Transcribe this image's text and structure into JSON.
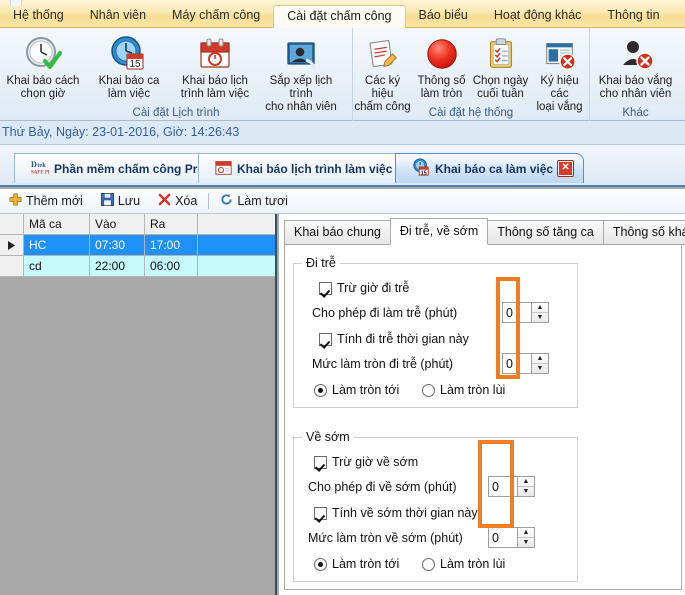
{
  "menubar": {
    "items": [
      {
        "label": "Hệ thống",
        "active": false
      },
      {
        "label": "Nhân viên",
        "active": false
      },
      {
        "label": "Máy chấm công",
        "active": false
      },
      {
        "label": "Cài đặt chấm công",
        "active": true
      },
      {
        "label": "Báo biểu",
        "active": false
      },
      {
        "label": "Hoạt động khác",
        "active": false
      },
      {
        "label": "Thông tin",
        "active": false
      }
    ]
  },
  "ribbon": {
    "groups": [
      {
        "label": "Cài đặt Lịch trình",
        "buttons": [
          {
            "caption": "Khai báo cách\nchọn giờ",
            "icon": "clock-check-icon"
          },
          {
            "caption": "Khai báo ca\nlàm việc",
            "icon": "clock-calendar-icon"
          },
          {
            "caption": "Khai báo lịch\ntrình làm việc",
            "icon": "calendar-clock-icon"
          },
          {
            "caption": "Sắp xếp lịch trình\ncho nhân viên",
            "icon": "person-photo-icon"
          }
        ]
      },
      {
        "label": "Cài đặt hệ thống",
        "buttons": [
          {
            "caption": "Các ký hiệu\nchấm công",
            "icon": "note-pencil-icon"
          },
          {
            "caption": "Thông số\nlàm tròn",
            "icon": "red-circle-icon"
          },
          {
            "caption": "Chọn ngày\ncuối tuần",
            "icon": "clipboard-check-icon"
          },
          {
            "caption": "Ký hiệu các\nloại vắng",
            "icon": "window-delete-icon"
          }
        ]
      },
      {
        "label": "Khác",
        "buttons": [
          {
            "caption": "Khai báo vắng\ncho nhân viên",
            "icon": "person-delete-icon"
          }
        ]
      }
    ]
  },
  "datebar": {
    "text": "Thứ Bảy, Ngày: 23-01-2016, Giờ: 14:26:43"
  },
  "doctabs": [
    {
      "label": "Phần mềm chấm công Pro",
      "icon": "app-logo-icon",
      "selected": false,
      "closable": false
    },
    {
      "label": "Khai báo lịch trình làm việc",
      "icon": "calendar-icon",
      "selected": false,
      "closable": true,
      "close_label": "✕"
    },
    {
      "label": "Khai báo ca làm việc",
      "icon": "clock-calendar-icon",
      "selected": true,
      "closable": true,
      "close_label": "✕"
    }
  ],
  "actionbar": {
    "buttons": [
      {
        "label": "Thêm mới",
        "icon": "plus-icon"
      },
      {
        "label": "Lưu",
        "icon": "save-icon"
      },
      {
        "label": "Xóa",
        "icon": "delete-x-icon"
      },
      {
        "label": "Làm tươi",
        "icon": "refresh-icon"
      }
    ]
  },
  "grid": {
    "columns": [
      "Mã ca",
      "Vào",
      "Ra"
    ],
    "rows": [
      {
        "ma_ca": "HC",
        "vao": "07:30",
        "ra": "17:00",
        "selected": true
      },
      {
        "ma_ca": "cd",
        "vao": "22:00",
        "ra": "06:00",
        "selected": false
      }
    ]
  },
  "panel": {
    "tabs": [
      {
        "label": "Khai báo chung",
        "selected": false
      },
      {
        "label": "Đi trễ, về sớm",
        "selected": true
      },
      {
        "label": "Thông số tăng ca",
        "selected": false
      },
      {
        "label": "Thông số khác",
        "selected": false
      }
    ],
    "late_group": {
      "title": "Đi trễ",
      "deduct_checkbox": {
        "label": "Trừ giờ đi trễ",
        "checked": true
      },
      "allow_label": "Cho phép đi làm trễ (phút)",
      "allow_value": "0",
      "count_checkbox": {
        "label": "Tính đi trễ thời gian này",
        "checked": true
      },
      "round_label": "Mức làm tròn đi trễ (phút)",
      "round_value": "0",
      "radio_up": {
        "label": "Làm tròn tới",
        "selected": true
      },
      "radio_down": {
        "label": "Làm tròn lùi",
        "selected": false
      }
    },
    "early_group": {
      "title": "Về sớm",
      "deduct_checkbox": {
        "label": "Trừ giờ về sớm",
        "checked": true
      },
      "allow_label": "Cho phép đi về sớm (phút)",
      "allow_value": "0",
      "count_checkbox": {
        "label": "Tính về sớm thời gian này",
        "checked": true
      },
      "round_label": "Mức làm tròn về sớm (phút)",
      "round_value": "0",
      "radio_up": {
        "label": "Làm tròn tới",
        "selected": true
      },
      "radio_down": {
        "label": "Làm tròn lùi",
        "selected": false
      }
    }
  },
  "highlights": {
    "accent_color": "#f07d20",
    "count": 2
  },
  "spinner_glyphs": {
    "up": "▲",
    "down": "▼"
  }
}
